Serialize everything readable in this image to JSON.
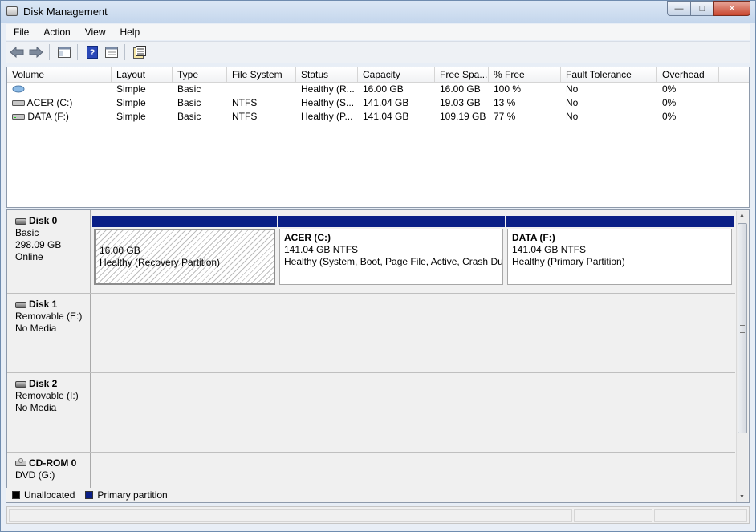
{
  "window": {
    "title": "Disk Management",
    "controls": {
      "minimize": "—",
      "maximize": "□",
      "close": "✕"
    }
  },
  "menu": [
    "File",
    "Action",
    "View",
    "Help"
  ],
  "toolbar": {
    "buttons": [
      "back-arrow-icon",
      "forward-arrow-icon",
      "console-tree-icon",
      "help-icon",
      "properties-icon",
      "export-list-icon"
    ]
  },
  "volume_list": {
    "columns": [
      "Volume",
      "Layout",
      "Type",
      "File System",
      "Status",
      "Capacity",
      "Free Spa...",
      "% Free",
      "Fault Tolerance",
      "Overhead"
    ],
    "rows": [
      {
        "volume": "",
        "layout": "Simple",
        "type": "Basic",
        "fs": "",
        "status": "Healthy (R...",
        "capacity": "16.00 GB",
        "free": "16.00 GB",
        "pct": "100 %",
        "fault": "No",
        "overhead": "0%"
      },
      {
        "volume": "ACER (C:)",
        "layout": "Simple",
        "type": "Basic",
        "fs": "NTFS",
        "status": "Healthy (S...",
        "capacity": "141.04 GB",
        "free": "19.03 GB",
        "pct": "13 %",
        "fault": "No",
        "overhead": "0%"
      },
      {
        "volume": "DATA (F:)",
        "layout": "Simple",
        "type": "Basic",
        "fs": "NTFS",
        "status": "Healthy (P...",
        "capacity": "141.04 GB",
        "free": "109.19 GB",
        "pct": "77 %",
        "fault": "No",
        "overhead": "0%"
      }
    ]
  },
  "disks": [
    {
      "name": "Disk 0",
      "line1": "Basic",
      "line2": "298.09 GB",
      "line3": "Online",
      "partitions": [
        {
          "title": "",
          "size": "16.00 GB",
          "status": "Healthy (Recovery Partition)"
        },
        {
          "title": "ACER  (C:)",
          "size": "141.04 GB NTFS",
          "status": "Healthy (System, Boot, Page File, Active, Crash Dur"
        },
        {
          "title": "DATA  (F:)",
          "size": "141.04 GB NTFS",
          "status": "Healthy (Primary Partition)"
        }
      ]
    },
    {
      "name": "Disk 1",
      "line1": "Removable (E:)",
      "line2": "",
      "line3": "No Media"
    },
    {
      "name": "Disk 2",
      "line1": "Removable (I:)",
      "line2": "",
      "line3": "No Media"
    },
    {
      "name": "CD-ROM 0",
      "line1": "DVD (G:)"
    }
  ],
  "legend": {
    "unallocated": "Unallocated",
    "primary": "Primary partition",
    "colors": {
      "unallocated": "#000000",
      "primary": "#0a1f86"
    }
  }
}
